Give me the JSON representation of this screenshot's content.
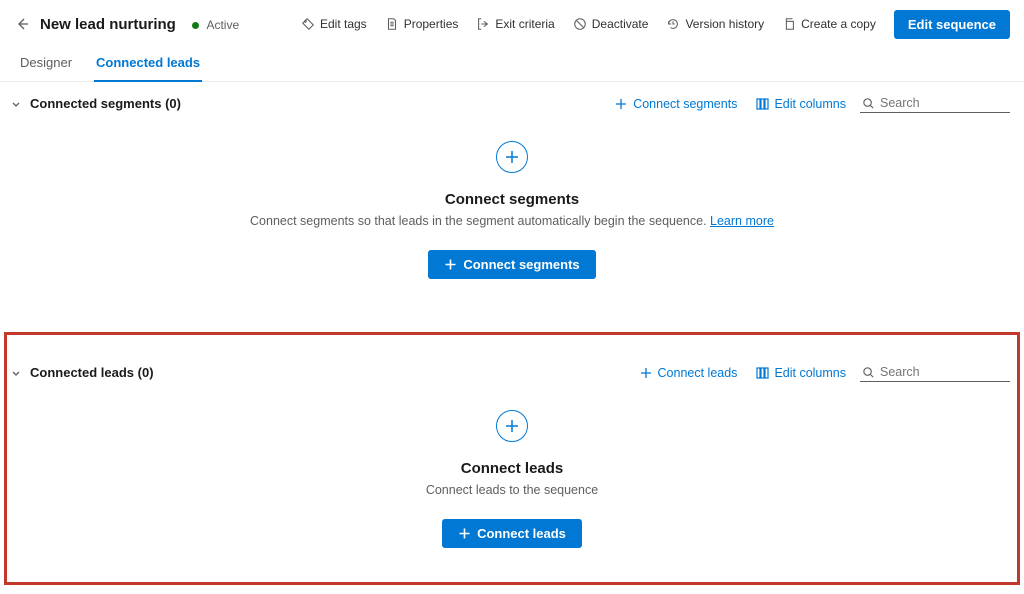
{
  "header": {
    "title": "New lead nurturing",
    "status_label": "Active",
    "commands": {
      "edit_tags": "Edit tags",
      "properties": "Properties",
      "exit_criteria": "Exit criteria",
      "deactivate": "Deactivate",
      "version_history": "Version history",
      "create_copy": "Create a copy",
      "edit_sequence": "Edit sequence"
    }
  },
  "tabs": {
    "designer": "Designer",
    "connected_leads": "Connected leads"
  },
  "segments": {
    "section_title": "Connected segments (0)",
    "connect_label": "Connect segments",
    "edit_columns": "Edit columns",
    "search_placeholder": "Search",
    "empty_title": "Connect segments",
    "empty_desc": "Connect segments so that leads in the segment automatically begin the sequence.",
    "learn_more": "Learn more",
    "cta": "Connect segments"
  },
  "leads": {
    "section_title": "Connected leads (0)",
    "connect_label": "Connect leads",
    "edit_columns": "Edit columns",
    "search_placeholder": "Search",
    "empty_title": "Connect leads",
    "empty_desc": "Connect leads to the sequence",
    "cta": "Connect leads"
  }
}
